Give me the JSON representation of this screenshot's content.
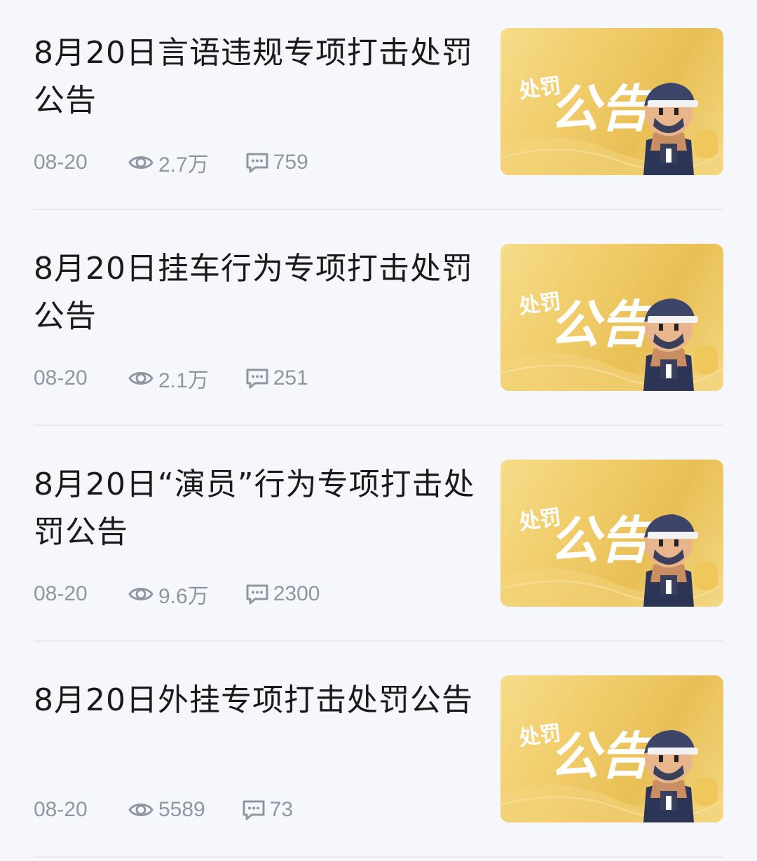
{
  "articles": [
    {
      "title": "8月20日言语违规专项打击处罚公告",
      "date": "08-20",
      "views": "2.7万",
      "comments": "759",
      "thumbnail": {
        "small_text": "处罚",
        "big_text": "公告"
      }
    },
    {
      "title": "8月20日挂车行为专项打击处罚公告",
      "date": "08-20",
      "views": "2.1万",
      "comments": "251",
      "thumbnail": {
        "small_text": "处罚",
        "big_text": "公告"
      }
    },
    {
      "title": "8月20日“演员”行为专项打击处罚公告",
      "date": "08-20",
      "views": "9.6万",
      "comments": "2300",
      "thumbnail": {
        "small_text": "处罚",
        "big_text": "公告"
      }
    },
    {
      "title": "8月20日外挂专项打击处罚公告",
      "date": "08-20",
      "views": "5589",
      "comments": "73",
      "thumbnail": {
        "small_text": "处罚",
        "big_text": "公告"
      }
    }
  ],
  "icons": {
    "views": "eye-icon",
    "comments": "comment-icon"
  },
  "colors": {
    "accent": "#f1cd6b",
    "meta_text": "#8f96a3",
    "title_text": "#1a1a1a",
    "background": "#f5f7fb"
  }
}
